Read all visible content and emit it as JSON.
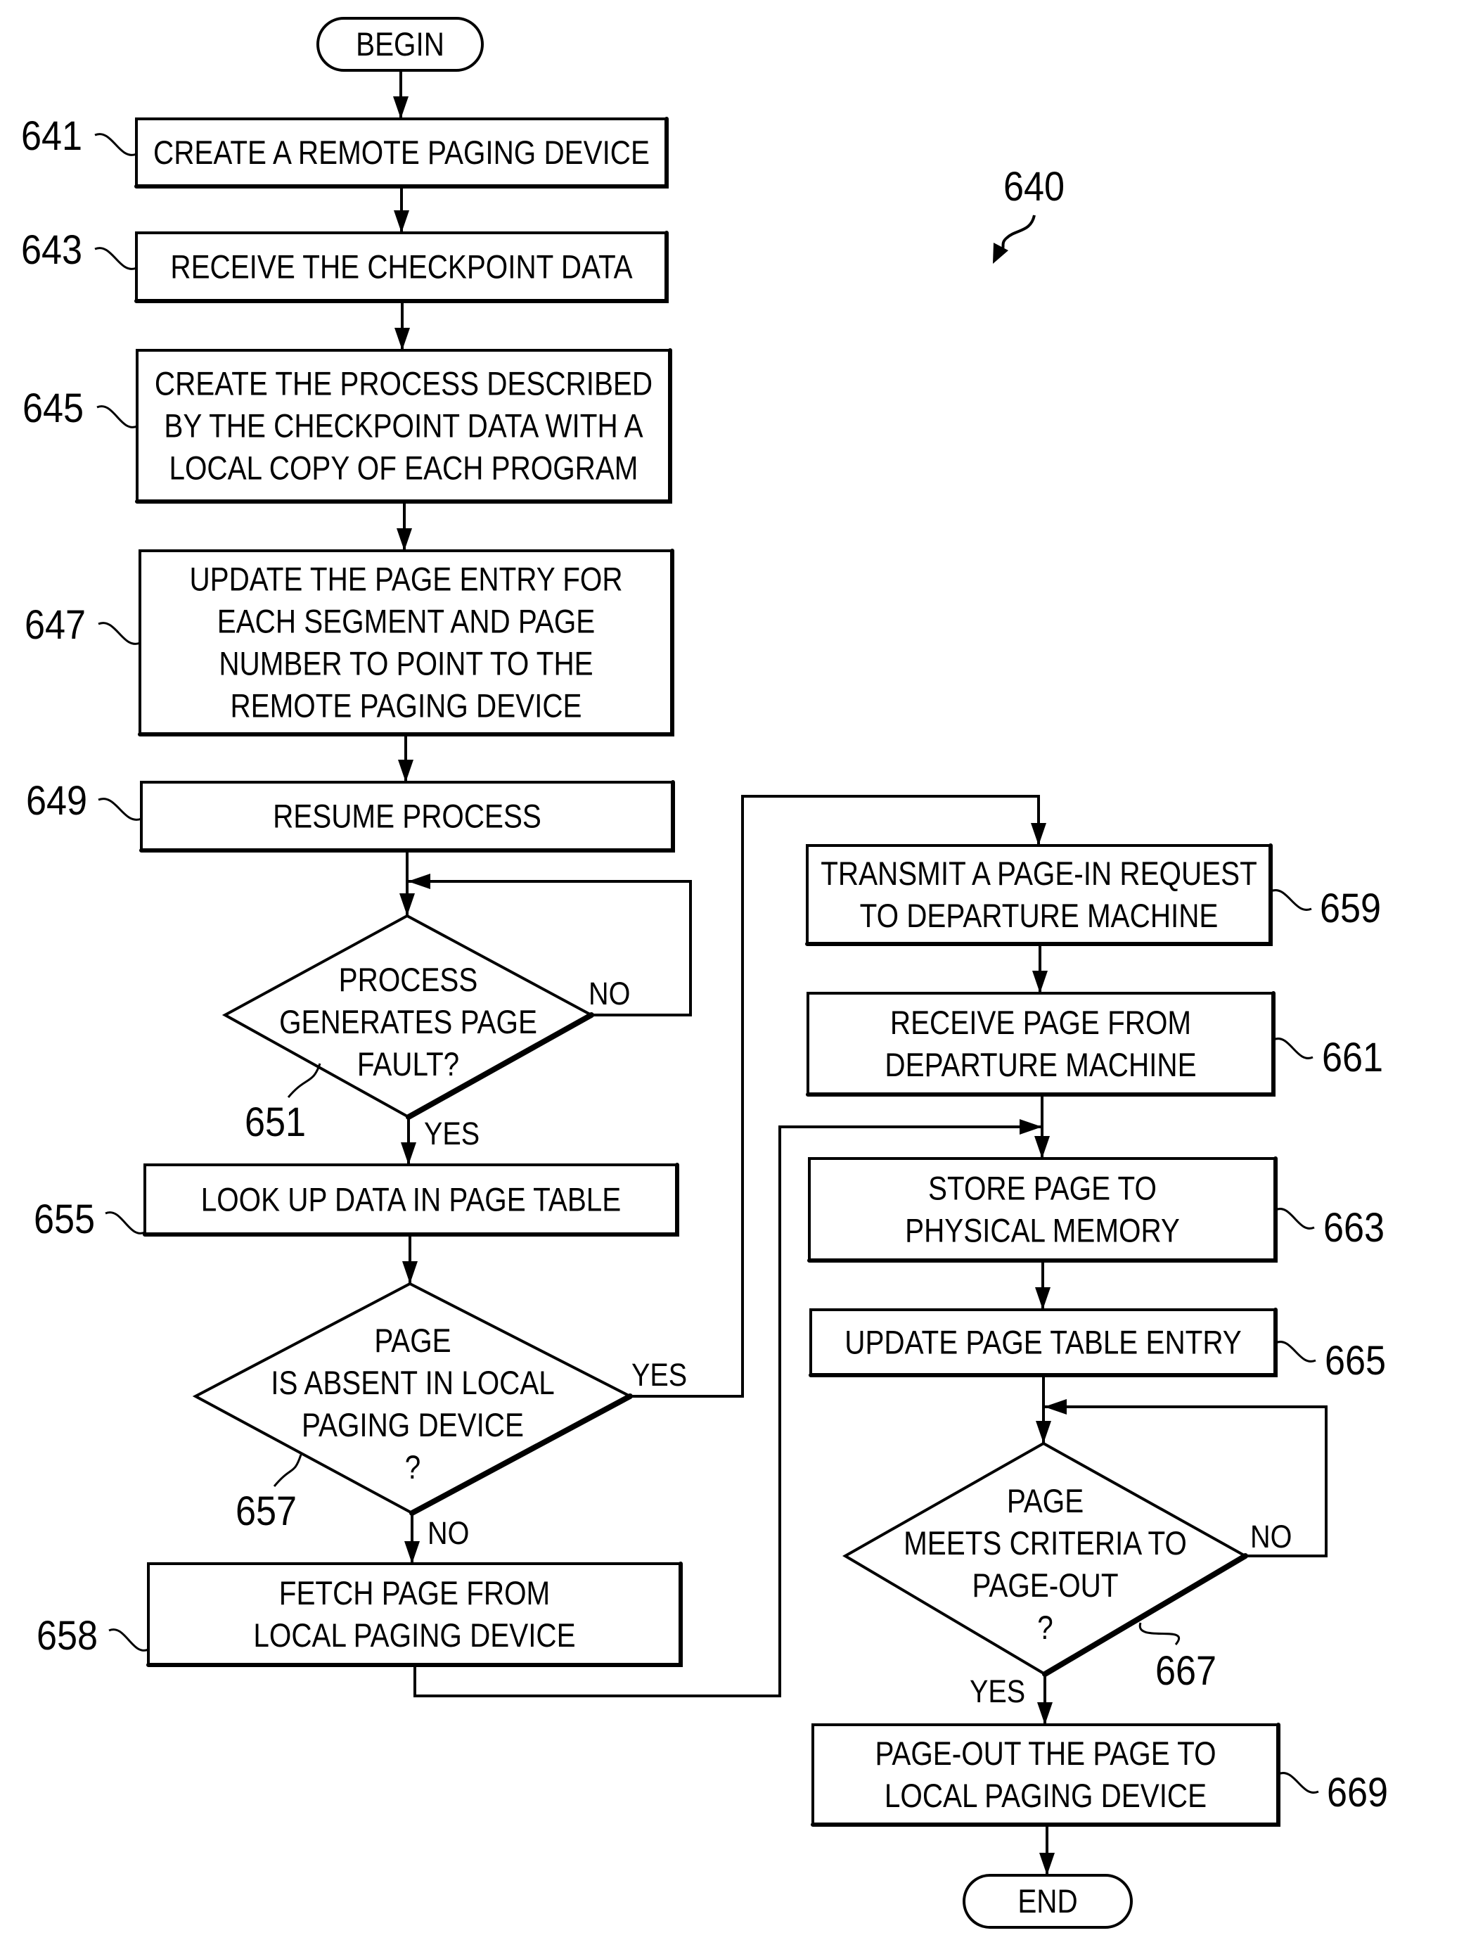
{
  "figure": {
    "reference": "640"
  },
  "nodes": {
    "begin": {
      "type": "terminal",
      "lines": [
        "BEGIN"
      ]
    },
    "n641": {
      "type": "process",
      "ref": "641",
      "lines": [
        "CREATE A REMOTE PAGING DEVICE"
      ]
    },
    "n643": {
      "type": "process",
      "ref": "643",
      "lines": [
        "RECEIVE THE CHECKPOINT DATA"
      ]
    },
    "n645": {
      "type": "process",
      "ref": "645",
      "lines": [
        "CREATE THE PROCESS DESCRIBED",
        "BY THE CHECKPOINT DATA WITH A",
        "LOCAL COPY OF EACH PROGRAM"
      ]
    },
    "n647": {
      "type": "process",
      "ref": "647",
      "lines": [
        "UPDATE THE PAGE ENTRY FOR",
        "EACH SEGMENT AND PAGE",
        "NUMBER TO POINT TO THE",
        "REMOTE PAGING DEVICE"
      ]
    },
    "n649": {
      "type": "process",
      "ref": "649",
      "lines": [
        "RESUME PROCESS"
      ]
    },
    "n651": {
      "type": "decision",
      "ref": "651",
      "lines": [
        "PROCESS",
        "GENERATES PAGE",
        "FAULT?"
      ]
    },
    "n655": {
      "type": "process",
      "ref": "655",
      "lines": [
        "LOOK UP DATA IN PAGE TABLE"
      ]
    },
    "n657": {
      "type": "decision",
      "ref": "657",
      "lines": [
        "PAGE",
        "IS ABSENT IN LOCAL",
        "PAGING DEVICE",
        "?"
      ]
    },
    "n658": {
      "type": "process",
      "ref": "658",
      "lines": [
        "FETCH PAGE FROM",
        "LOCAL PAGING DEVICE"
      ]
    },
    "n659": {
      "type": "process",
      "ref": "659",
      "lines": [
        "TRANSMIT A PAGE-IN REQUEST",
        "TO DEPARTURE MACHINE"
      ]
    },
    "n661": {
      "type": "process",
      "ref": "661",
      "lines": [
        "RECEIVE PAGE FROM",
        "DEPARTURE MACHINE"
      ]
    },
    "n663": {
      "type": "process",
      "ref": "663",
      "lines": [
        "STORE PAGE TO",
        "PHYSICAL MEMORY"
      ]
    },
    "n665": {
      "type": "process",
      "ref": "665",
      "lines": [
        "UPDATE PAGE TABLE ENTRY"
      ]
    },
    "n667": {
      "type": "decision",
      "ref": "667",
      "lines": [
        "PAGE",
        "MEETS CRITERIA TO",
        "PAGE-OUT",
        "?"
      ]
    },
    "n669": {
      "type": "process",
      "ref": "669",
      "lines": [
        "PAGE-OUT THE PAGE TO",
        "LOCAL PAGING DEVICE"
      ]
    },
    "end": {
      "type": "terminal",
      "lines": [
        "END"
      ]
    }
  },
  "branches": {
    "n651_no": "NO",
    "n651_yes": "YES",
    "n657_yes": "YES",
    "n657_no": "NO",
    "n667_no": "NO",
    "n667_yes": "YES"
  },
  "edges": [
    {
      "from": "begin",
      "to": "n641"
    },
    {
      "from": "n641",
      "to": "n643"
    },
    {
      "from": "n643",
      "to": "n645"
    },
    {
      "from": "n645",
      "to": "n647"
    },
    {
      "from": "n647",
      "to": "n649"
    },
    {
      "from": "n649",
      "to": "n651"
    },
    {
      "from": "n651",
      "to": "n651",
      "label": "NO"
    },
    {
      "from": "n651",
      "to": "n655",
      "label": "YES"
    },
    {
      "from": "n655",
      "to": "n657"
    },
    {
      "from": "n657",
      "to": "n659",
      "label": "YES"
    },
    {
      "from": "n657",
      "to": "n658",
      "label": "NO"
    },
    {
      "from": "n658",
      "to": "n663"
    },
    {
      "from": "n659",
      "to": "n661"
    },
    {
      "from": "n661",
      "to": "n663"
    },
    {
      "from": "n663",
      "to": "n665"
    },
    {
      "from": "n665",
      "to": "n667"
    },
    {
      "from": "n667",
      "to": "n667",
      "label": "NO"
    },
    {
      "from": "n667",
      "to": "n669",
      "label": "YES"
    },
    {
      "from": "n669",
      "to": "end"
    }
  ]
}
